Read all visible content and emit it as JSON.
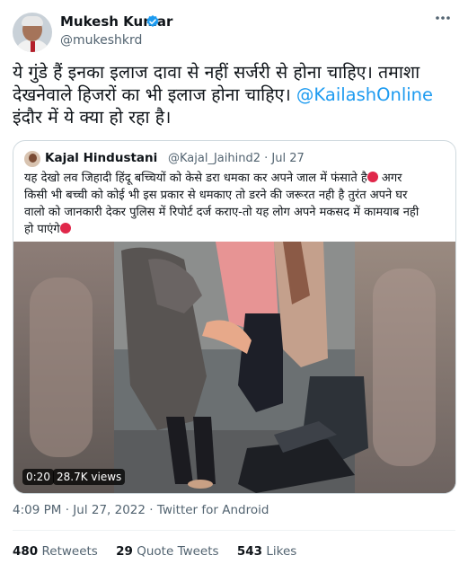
{
  "author": {
    "name": "Mukesh Kumar",
    "handle": "@mukeshkrd"
  },
  "tweet": {
    "line1": "ये गुंडे हैं इनका इलाज दावा से नहीं सर्जरी से होना चाहिए। तमाशा",
    "line2_text": "देखनेवाले हिजरों का भी इलाज होना चाहिए। ",
    "line2_mention": "@KailashOnline",
    "line3": "इंदौर में ये क्या हो रहा है।"
  },
  "quoted": {
    "name": "Kajal Hindustani",
    "handle_date": "@Kajal_Jaihind2 · Jul 27",
    "line1": "यह देखो लव जिहादी हिंदू बच्चियों को केसे डरा धमका कर अपने जाल में फंसाते है",
    "line1_after": " अगर",
    "line2": "किसी भी बच्ची को कोई भी इस प्रकार से धमकाए तो डरने की जरूरत नही है तुरंत अपने घर",
    "line3": "वालो को जानकारी देकर पुलिस में रिपोर्ट दर्ज कराए-तो यह लोग अपने मकसद में कामयाब नही",
    "line4": "हो पाएंगे",
    "emoji": "angry-face-icon",
    "video": {
      "time": "0:20",
      "views": "28.7K views"
    }
  },
  "meta": {
    "time": "4:09 PM",
    "sep1": " · ",
    "date": "Jul 27, 2022",
    "sep2": " · ",
    "source": "Twitter for Android"
  },
  "stats": {
    "retweets_count": "480",
    "retweets_label": "Retweets",
    "quotes_count": "29",
    "quotes_label": "Quote Tweets",
    "likes_count": "543",
    "likes_label": "Likes"
  },
  "colors": {
    "accent": "#1d9bf0",
    "secondary_text": "#536471",
    "border": "#cfd9de"
  }
}
